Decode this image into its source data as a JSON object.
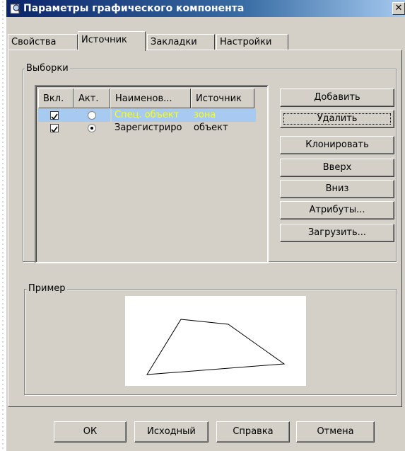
{
  "window": {
    "title": "Параметры графического компонента",
    "close_glyph": "✕"
  },
  "tabs": [
    {
      "label": "Свойства",
      "active": false
    },
    {
      "label": "Источник",
      "active": true
    },
    {
      "label": "Закладки",
      "active": false
    },
    {
      "label": "Настройки",
      "active": false
    }
  ],
  "samples_group": {
    "label": "Выборки",
    "columns": [
      "Вкл.",
      "Акт.",
      "Наименов...",
      "Источник"
    ],
    "rows": [
      {
        "enabled": true,
        "active": false,
        "name": "Спец. объект",
        "source": "зона",
        "selected": true
      },
      {
        "enabled": true,
        "active": true,
        "name": "Зарегистриро",
        "source": "объект",
        "selected": false
      }
    ]
  },
  "side_buttons": {
    "add": "Добавить",
    "delete": "Удалить",
    "clone": "Клонировать",
    "up": "Вверх",
    "down": "Вниз",
    "attributes": "Атрибуты...",
    "load": "Загрузить..."
  },
  "example_group": {
    "label": "Пример"
  },
  "footer_buttons": {
    "ok": "ОК",
    "original": "Исходный",
    "help": "Справка",
    "cancel": "Отмена"
  },
  "colors": {
    "selection": "#a6caf0",
    "selected_text": "#ffff00",
    "dialog_face": "#d4d0c8",
    "title_gradient_start": "#0a246a"
  }
}
